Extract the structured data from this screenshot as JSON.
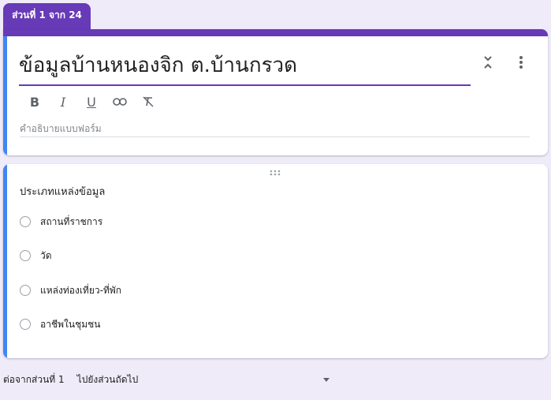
{
  "section_tab": {
    "label": "ส่วนที่ 1 จาก 24"
  },
  "header": {
    "title": "ข้อมูลบ้านหนองจิก ต.บ้านกรวด",
    "description_placeholder": "คำอธิบายแบบฟอร์ม",
    "icons": [
      "collapse-icon",
      "more-vert-icon"
    ]
  },
  "toolbar": {
    "bold": "B",
    "italic": "I",
    "underline": "U",
    "icons": [
      "link-icon",
      "clear-format-icon"
    ]
  },
  "question": {
    "title": "ประเภทแหล่งข้อมูล",
    "options": [
      "สถานที่ราชการ",
      "วัด",
      "แหล่งท่องเที่ยว-ที่พัก",
      "อาชีพในชุมชน"
    ]
  },
  "footer": {
    "after_label": "ต่อจากส่วนที่ 1",
    "next_value": "ไปยังส่วนถัดไป"
  },
  "colors": {
    "accent": "#673ab7",
    "focus_bar": "#4285f4",
    "background": "#efebf8"
  }
}
